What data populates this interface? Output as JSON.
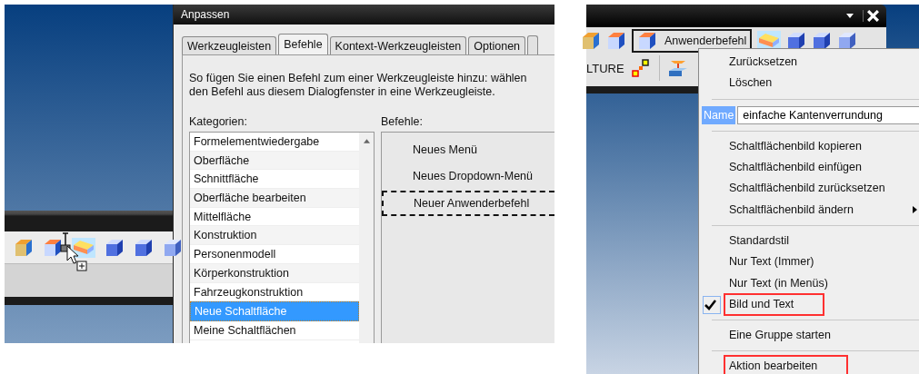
{
  "customize_dialog": {
    "title": "Anpassen",
    "tabs": [
      {
        "label": "Werkzeugleisten",
        "selected": false
      },
      {
        "label": "Befehle",
        "selected": true
      },
      {
        "label": "Kontext-Werkzeugleisten",
        "selected": false
      },
      {
        "label": "Optionen",
        "selected": false
      }
    ],
    "instructions": [
      "So fügen Sie einen Befehl zum einer Werkzeugleiste hinzu: wählen",
      "den Befehl aus diesem Dialogfenster in eine Werkzeugleiste."
    ],
    "categories_label": "Kategorien:",
    "categories": [
      {
        "label": "Formelementwiedergabe",
        "selected": false
      },
      {
        "label": "Oberfläche",
        "selected": false
      },
      {
        "label": "Schnittfläche",
        "selected": false
      },
      {
        "label": "Oberfläche bearbeiten",
        "selected": false
      },
      {
        "label": "Mittelfläche",
        "selected": false
      },
      {
        "label": "Konstruktion",
        "selected": false
      },
      {
        "label": "Personenmodell",
        "selected": false
      },
      {
        "label": "Körperkonstruktion",
        "selected": false
      },
      {
        "label": "Fahrzeugkonstruktion",
        "selected": false
      },
      {
        "label": "Neue Schaltfläche",
        "selected": true
      },
      {
        "label": "Meine Schaltflächen",
        "selected": false
      }
    ],
    "commands_label": "Befehle:",
    "commands": [
      {
        "label": "Neues Menü",
        "focused": false
      },
      {
        "label": "Neues Dropdown-Menü",
        "focused": false
      },
      {
        "label": "Neuer Anwenderbefehl",
        "focused": true
      }
    ]
  },
  "right_toolbar": {
    "button_label": "Anwenderbefehl",
    "cut_label": "LTURE"
  },
  "context_menu": {
    "items": [
      {
        "kind": "item",
        "label": "Zurücksetzen",
        "checked": false,
        "highlighted": false,
        "submenu": false
      },
      {
        "kind": "item",
        "label": "Löschen",
        "checked": false,
        "highlighted": false,
        "submenu": false
      },
      {
        "kind": "separator"
      },
      {
        "kind": "name-field",
        "label": "Name",
        "value": "einfache Kantenverrundung"
      },
      {
        "kind": "separator"
      },
      {
        "kind": "item",
        "label": "Schaltflächenbild kopieren",
        "checked": false,
        "highlighted": false,
        "submenu": false
      },
      {
        "kind": "item",
        "label": "Schaltflächenbild einfügen",
        "checked": false,
        "highlighted": false,
        "submenu": false
      },
      {
        "kind": "item",
        "label": "Schaltflächenbild zurücksetzen",
        "checked": false,
        "highlighted": false,
        "submenu": false
      },
      {
        "kind": "item",
        "label": "Schaltflächenbild ändern",
        "checked": false,
        "highlighted": false,
        "submenu": true
      },
      {
        "kind": "separator"
      },
      {
        "kind": "item",
        "label": "Standardstil",
        "checked": false,
        "highlighted": false,
        "submenu": false
      },
      {
        "kind": "item",
        "label": "Nur Text (Immer)",
        "checked": false,
        "highlighted": false,
        "submenu": false
      },
      {
        "kind": "item",
        "label": "Nur Text (in Menüs)",
        "checked": false,
        "highlighted": false,
        "submenu": false
      },
      {
        "kind": "item",
        "label": "Bild und Text",
        "checked": true,
        "highlighted": true,
        "submenu": false
      },
      {
        "kind": "separator"
      },
      {
        "kind": "item",
        "label": "Eine Gruppe starten",
        "checked": false,
        "highlighted": false,
        "submenu": false
      },
      {
        "kind": "separator"
      },
      {
        "kind": "item",
        "label": "Aktion bearbeiten",
        "checked": false,
        "highlighted": true,
        "submenu": false
      }
    ]
  }
}
